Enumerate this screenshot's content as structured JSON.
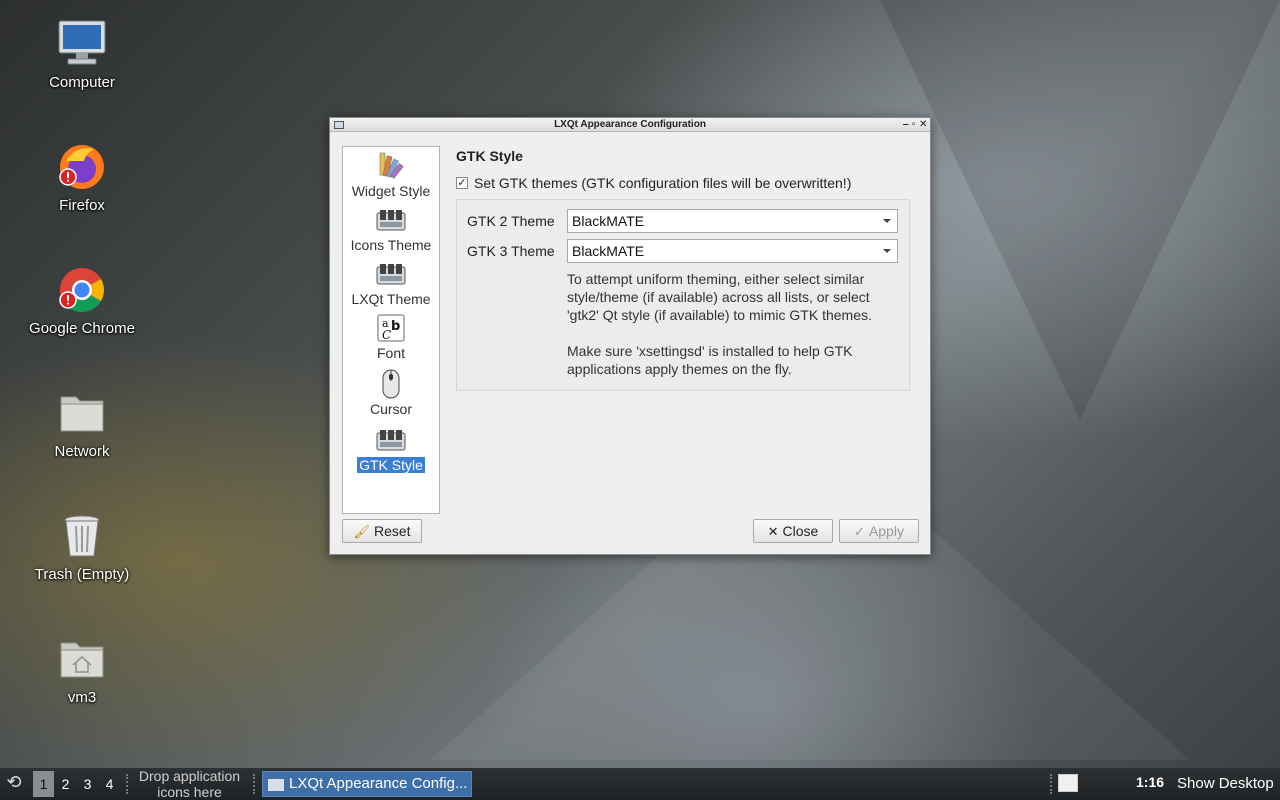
{
  "desktop": {
    "icons": [
      {
        "label": "Computer"
      },
      {
        "label": "Firefox"
      },
      {
        "label": "Google Chrome"
      },
      {
        "label": "Network"
      },
      {
        "label": "Trash (Empty)"
      },
      {
        "label": "vm3"
      }
    ]
  },
  "window": {
    "title": "LXQt Appearance Configuration",
    "sidebar": {
      "items": [
        {
          "label": "Widget Style",
          "icon": "palette-icon"
        },
        {
          "label": "Icons Theme",
          "icon": "theme-icon"
        },
        {
          "label": "LXQt Theme",
          "icon": "theme-icon"
        },
        {
          "label": "Font",
          "icon": "font-icon"
        },
        {
          "label": "Cursor",
          "icon": "mouse-icon"
        },
        {
          "label": "GTK Style",
          "icon": "theme-icon",
          "selected": true
        }
      ]
    },
    "content": {
      "heading": "GTK Style",
      "checkbox_label": "Set GTK themes (GTK configuration files will be overwritten!)",
      "checkbox_checked": true,
      "gtk2_label": "GTK 2 Theme",
      "gtk2_value": "BlackMATE",
      "gtk3_label": "GTK 3 Theme",
      "gtk3_value": "BlackMATE",
      "note1": "To attempt uniform theming, either select similar style/theme (if available) across all lists, or select 'gtk2' Qt style (if available) to mimic GTK themes.",
      "note2": "Make sure 'xsettingsd' is installed to help GTK applications apply themes on the fly."
    },
    "buttons": {
      "reset": "Reset",
      "close": "Close",
      "apply": "Apply"
    }
  },
  "taskbar": {
    "workspaces": [
      "1",
      "2",
      "3",
      "4"
    ],
    "active_workspace": "1",
    "quicklaunch_line1": "Drop application",
    "quicklaunch_line2": "icons here",
    "task_label": "LXQt Appearance Config...",
    "clock": "1:16",
    "show_desktop": "Show Desktop"
  }
}
